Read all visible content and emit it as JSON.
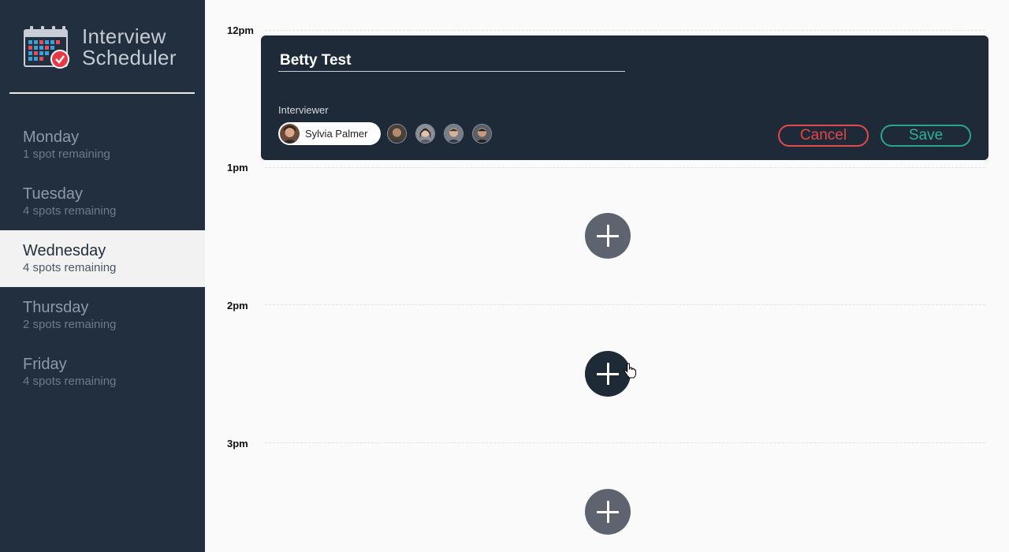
{
  "app": {
    "title_line1": "Interview",
    "title_line2": "Scheduler",
    "logo_icon": "calendar-check-icon"
  },
  "days": [
    {
      "name": "Monday",
      "spots": "1 spot remaining",
      "selected": false
    },
    {
      "name": "Tuesday",
      "spots": "4 spots remaining",
      "selected": false
    },
    {
      "name": "Wednesday",
      "spots": "4 spots remaining",
      "selected": true
    },
    {
      "name": "Thursday",
      "spots": "2 spots remaining",
      "selected": false
    },
    {
      "name": "Friday",
      "spots": "4 spots remaining",
      "selected": false
    }
  ],
  "schedule": {
    "hours": [
      "12pm",
      "1pm",
      "2pm",
      "3pm"
    ]
  },
  "form": {
    "student_name": "Betty Test",
    "interviewer_label": "Interviewer",
    "selected_interviewer": "Sylvia Palmer",
    "interviewer_count": 5,
    "cancel_label": "Cancel",
    "save_label": "Save"
  },
  "colors": {
    "sidebar": "#222f3e",
    "form_bg": "#1e2a38",
    "cancel": "#e24b4b",
    "save": "#2ca58d",
    "add_button": "#5d6470"
  }
}
